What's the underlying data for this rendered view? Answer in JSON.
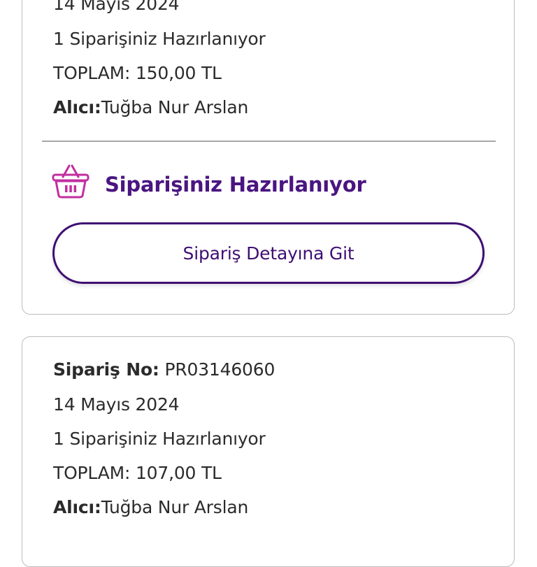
{
  "colors": {
    "accent": "#4a1581",
    "button_border": "#3f0f73",
    "icon": "#c12f9f",
    "text": "#2b2b2b",
    "card_border": "#bdbdbd"
  },
  "orders": [
    {
      "date": "14 Mayıs 2024",
      "status_count": "1 Siparişiniz Hazırlanıyor",
      "total": "TOPLAM: 150,00 TL",
      "recipient_label": "Alıcı:",
      "recipient_name": "Tuğba Nur Arslan",
      "status_icon": "shopping-basket-icon",
      "status_text": "Siparişiniz Hazırlanıyor",
      "detail_button_label": "Sipariş Detayına Git"
    },
    {
      "order_no_label": "Sipariş No:",
      "order_no": " PR03146060",
      "date": "14 Mayıs 2024",
      "status_count": "1 Siparişiniz Hazırlanıyor",
      "total": "TOPLAM: 107,00 TL",
      "recipient_label": "Alıcı:",
      "recipient_name": "Tuğba Nur Arslan"
    }
  ]
}
